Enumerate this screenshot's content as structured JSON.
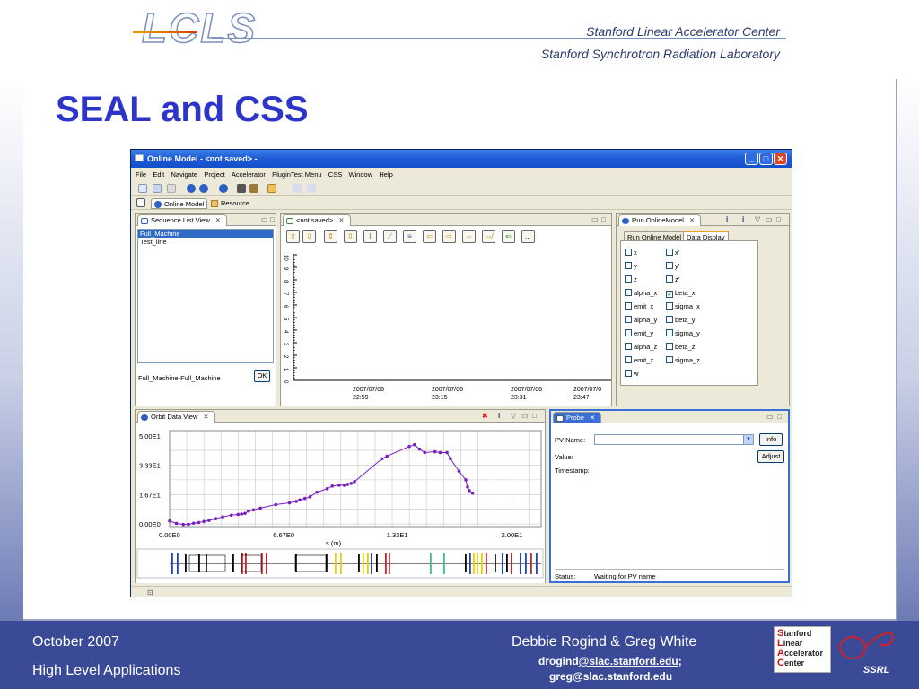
{
  "header": {
    "logo": "LCLS",
    "org1": "Stanford Linear Accelerator Center",
    "org2": "Stanford Synchrotron Radiation Laboratory"
  },
  "slide_title": "SEAL and CSS",
  "footer": {
    "date": "October  2007",
    "subtitle": "High Level Applications",
    "authors": "Debbie Rogind & Greg White",
    "email1_prefix": "drogind",
    "email1_link": "@slac.stanford.edu",
    "email1_suffix": ";",
    "email2": "greg@slac.stanford.edu",
    "slac_logo_lines": [
      "Stanford",
      "Linear",
      "Accelerator",
      "Center"
    ],
    "ssrl_logo": "SSRL"
  },
  "window": {
    "title": "Online Model - <not saved> -",
    "menu": [
      "File",
      "Edit",
      "Navigate",
      "Project",
      "Accelerator",
      "PluginTest Menu",
      "CSS",
      "Window",
      "Help"
    ],
    "perspectives": [
      "Online Model",
      "Resource"
    ]
  },
  "sequence_panel": {
    "tab": "Sequence List View",
    "items": [
      "Full_Machine",
      "Test_line"
    ],
    "selected_index": 0,
    "footer_text": "Full_Machine-Full_Machine",
    "ok_label": "OK"
  },
  "plot_panel": {
    "tab": "<not saved>",
    "toolbar_icons": [
      "arrow-up-icon",
      "arrow-down-icon",
      "expand-v-icon",
      "expand-v2-icon",
      "plot-icon",
      "line-chart-icon",
      "table-icon",
      "arrow-left-icon",
      "arrow-right-icon",
      "expand-h-icon",
      "shrink-h-icon",
      "back-icon",
      "more-icon"
    ],
    "more_label": "...",
    "y_ticks": [
      "0",
      "1",
      "2",
      "3",
      "4",
      "5",
      "6",
      "7",
      "8",
      "9",
      "10"
    ],
    "x_ticks": [
      {
        "date": "2007/07/06",
        "time": "22:59"
      },
      {
        "date": "2007/07/06",
        "time": "23:15"
      },
      {
        "date": "2007/07/06",
        "time": "23:31"
      },
      {
        "date": "2007/07/0",
        "time": "23:47"
      }
    ]
  },
  "run_panel": {
    "tab": "Run OnlineModel",
    "subtabs": [
      "Run Online Model",
      "Data Display"
    ],
    "active_subtab": 1,
    "checkboxes": [
      {
        "label": "x",
        "checked": false
      },
      {
        "label": "x'",
        "checked": false
      },
      {
        "label": "y",
        "checked": false
      },
      {
        "label": "y'",
        "checked": false
      },
      {
        "label": "z",
        "checked": false
      },
      {
        "label": "z'",
        "checked": false
      },
      {
        "label": "alpha_x",
        "checked": false
      },
      {
        "label": "beta_x",
        "checked": true
      },
      {
        "label": "emit_x",
        "checked": false
      },
      {
        "label": "sigma_x",
        "checked": false
      },
      {
        "label": "alpha_y",
        "checked": false
      },
      {
        "label": "beta_y",
        "checked": false
      },
      {
        "label": "emit_y",
        "checked": false
      },
      {
        "label": "sigma_y",
        "checked": false
      },
      {
        "label": "alpha_z",
        "checked": false
      },
      {
        "label": "beta_z",
        "checked": false
      },
      {
        "label": "emit_z",
        "checked": false
      },
      {
        "label": "sigma_z",
        "checked": false
      },
      {
        "label": "w",
        "checked": false
      }
    ]
  },
  "orbit_panel": {
    "tab": "Orbit Data View"
  },
  "probe_panel": {
    "tab": "Probe",
    "pv_name_label": "PV Name:",
    "value_label": "Value:",
    "timestamp_label": "Timestamp:",
    "info_label": "Info",
    "adjust_label": "Adjust",
    "status_label": "Status:",
    "status_text": "Waiting for PV name"
  },
  "chart_data": {
    "type": "line",
    "xlabel": "s (m)",
    "ylabel": "",
    "x_tick_labels": [
      "0.00E0",
      "6.67E0",
      "1.33E1",
      "2.00E1"
    ],
    "y_tick_labels": [
      "0.00E0",
      "1.67E1",
      "3.33E1",
      "5.00E1"
    ],
    "xlim": [
      0,
      21.7
    ],
    "ylim": [
      -1.5,
      53
    ],
    "series": [
      {
        "color": "#7a1fc2",
        "x": [
          0.0,
          0.4,
          0.8,
          1.1,
          1.4,
          1.7,
          2.0,
          2.3,
          2.7,
          3.1,
          3.6,
          4.0,
          4.2,
          4.4,
          4.6,
          4.9,
          5.3,
          6.2,
          7.0,
          7.4,
          7.6,
          7.9,
          8.2,
          8.6,
          9.2,
          9.5,
          9.9,
          10.2,
          10.4,
          10.6,
          10.8,
          12.4,
          12.7,
          14.0,
          14.3,
          14.6,
          14.9,
          15.5,
          15.8,
          16.2,
          16.4,
          16.9,
          17.3,
          17.4,
          17.5,
          17.7
        ],
        "y": [
          1.7,
          0.3,
          -0.3,
          -0.2,
          0.4,
          0.8,
          1.4,
          2.0,
          3.0,
          4.0,
          5.0,
          5.4,
          5.6,
          6.0,
          7.3,
          8.0,
          9.0,
          11.0,
          12.0,
          12.8,
          13.6,
          14.5,
          15.4,
          18.0,
          20.0,
          21.5,
          22.0,
          22.0,
          22.5,
          23.0,
          24.0,
          37.0,
          38.5,
          44.0,
          45.0,
          42.5,
          40.5,
          41.0,
          40.5,
          40.5,
          37.0,
          30.0,
          25.0,
          21.0,
          19.0,
          17.5
        ]
      }
    ]
  },
  "colors": {
    "title_blue": "#2d34c9",
    "footer_blue": "#3a4a97",
    "titlebar_blue": "#1d5ad6",
    "plot_purple": "#7a1fc2"
  }
}
